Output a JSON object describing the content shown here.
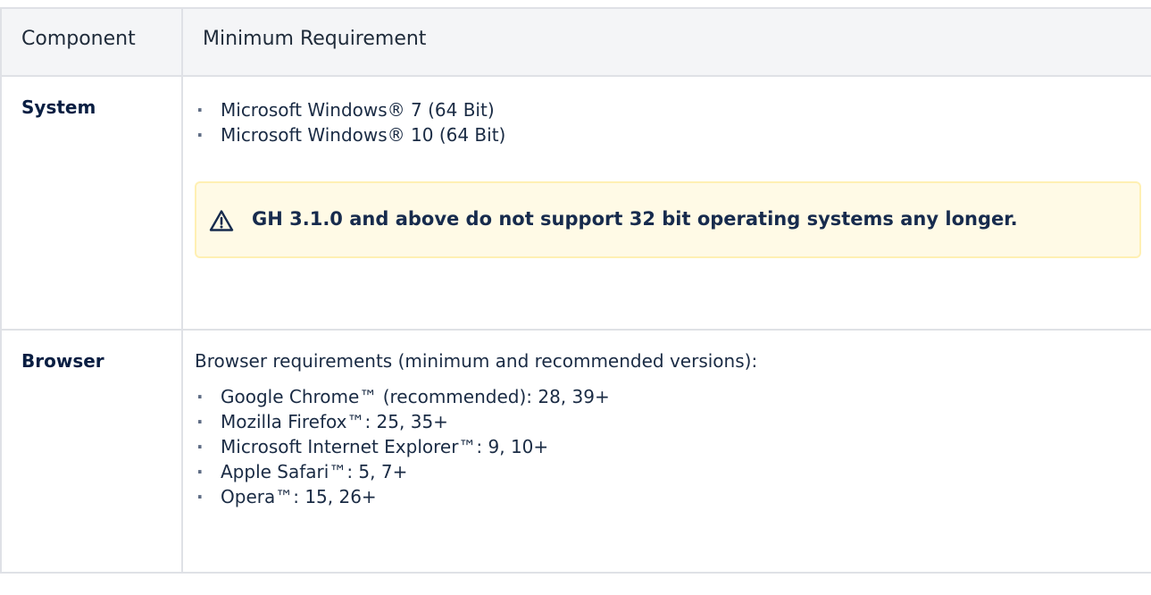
{
  "table": {
    "headers": {
      "component": "Component",
      "requirement": "Minimum Requirement"
    },
    "rows": [
      {
        "component": "System",
        "items": [
          "Microsoft Windows® 7 (64 Bit)",
          "Microsoft Windows® 10 (64 Bit)"
        ],
        "note": {
          "icon": "warning-icon",
          "text": "GH 3.1.0 and above do not support 32 bit operating systems any longer."
        }
      },
      {
        "component": "Browser",
        "intro": "Browser requirements (minimum and recommended versions):",
        "items": [
          "Google Chrome™ (recommended): 28, 39+",
          "Mozilla Firefox™: 25, 35+",
          "Microsoft Internet Explorer™: 9, 10+",
          "Apple Safari™: 5, 7+",
          "Opera™: 15, 26+"
        ]
      }
    ]
  },
  "colors": {
    "header_bg": "#f4f5f7",
    "border": "#dfe1e6",
    "note_bg": "#fffae6",
    "note_border": "#fff0b3",
    "warning_icon": "#172b4d"
  }
}
